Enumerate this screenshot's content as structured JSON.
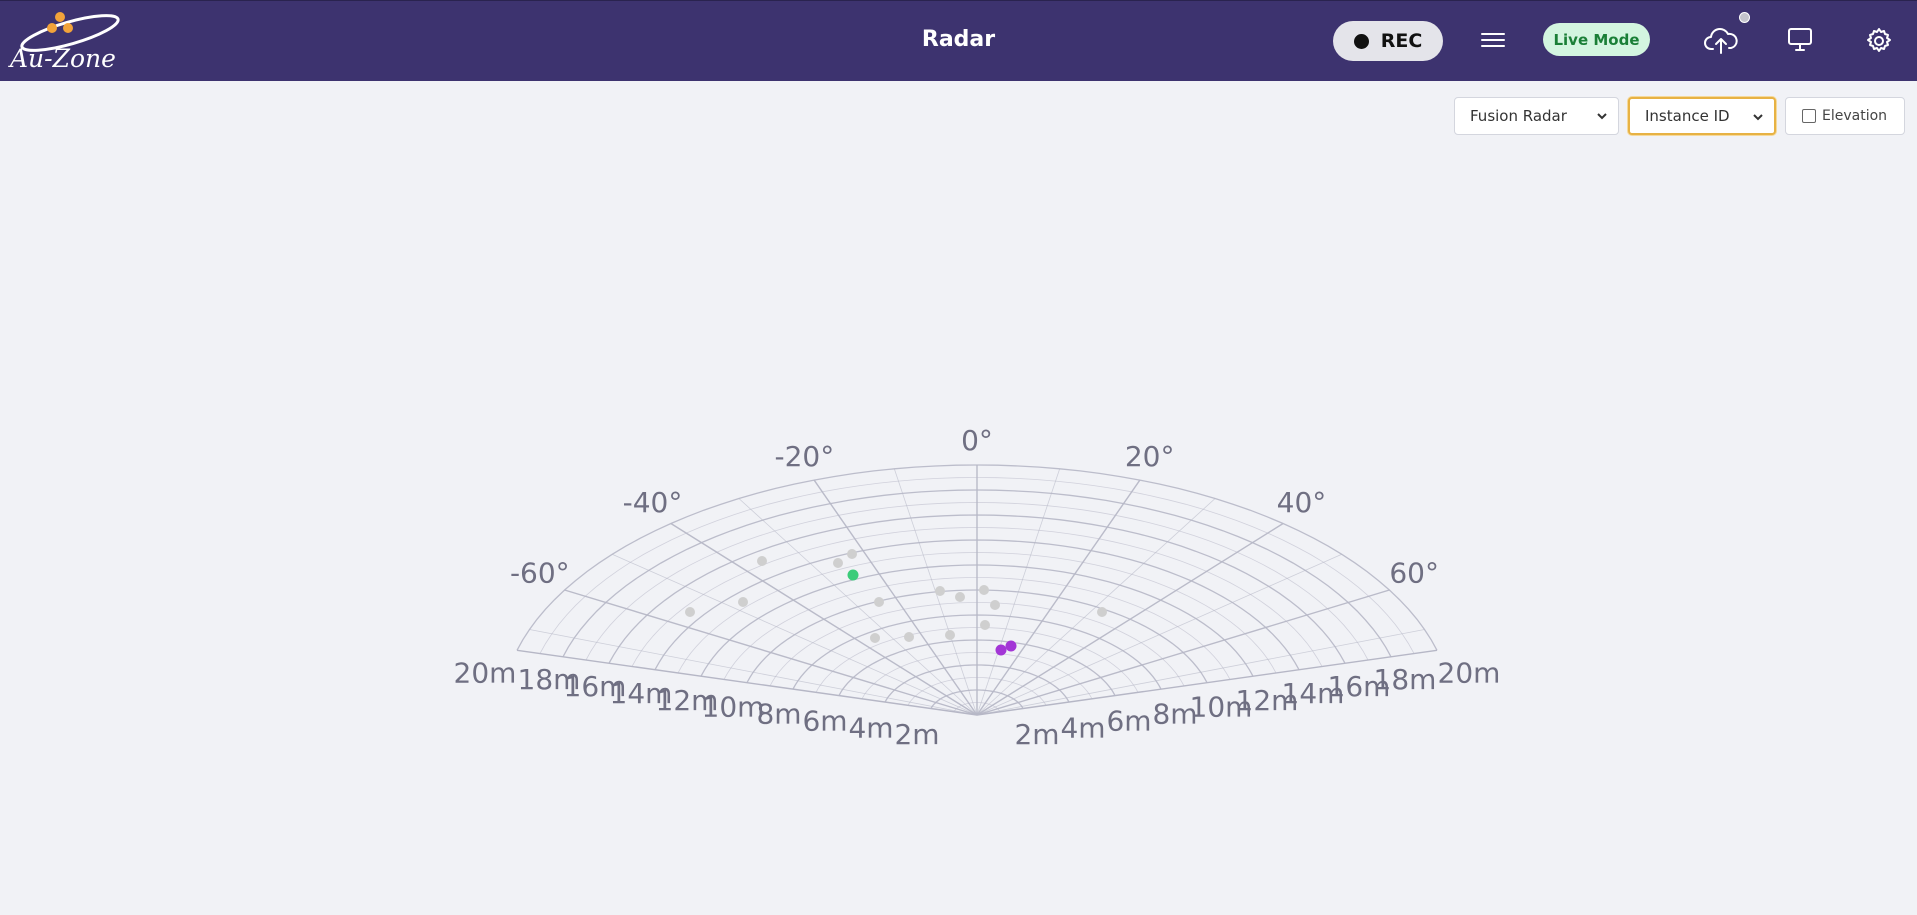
{
  "header": {
    "logo_text": "Au-Zone",
    "title": "Radar",
    "rec_label": "REC",
    "live_mode_label": "Live Mode"
  },
  "toolbar": {
    "source_select": "Fusion Radar",
    "color_select": "Instance ID",
    "elevation_label": "Elevation",
    "elevation_checked": false
  },
  "radar": {
    "angle_labels": [
      "-60°",
      "-40°",
      "-20°",
      "0°",
      "20°",
      "40°",
      "60°"
    ],
    "range_labels": [
      "2m",
      "4m",
      "6m",
      "8m",
      "10m",
      "12m",
      "14m",
      "16m",
      "18m",
      "20m"
    ],
    "colors": {
      "grid": "#b6b7c6",
      "background_point": "#cfcfcf",
      "instance_1": "#3ccc7a",
      "instance_2": "#a336d6"
    }
  },
  "icons": [
    "menu-icon",
    "cloud-upload-icon",
    "monitor-icon",
    "gear-icon",
    "chevron-down-icon"
  ]
}
